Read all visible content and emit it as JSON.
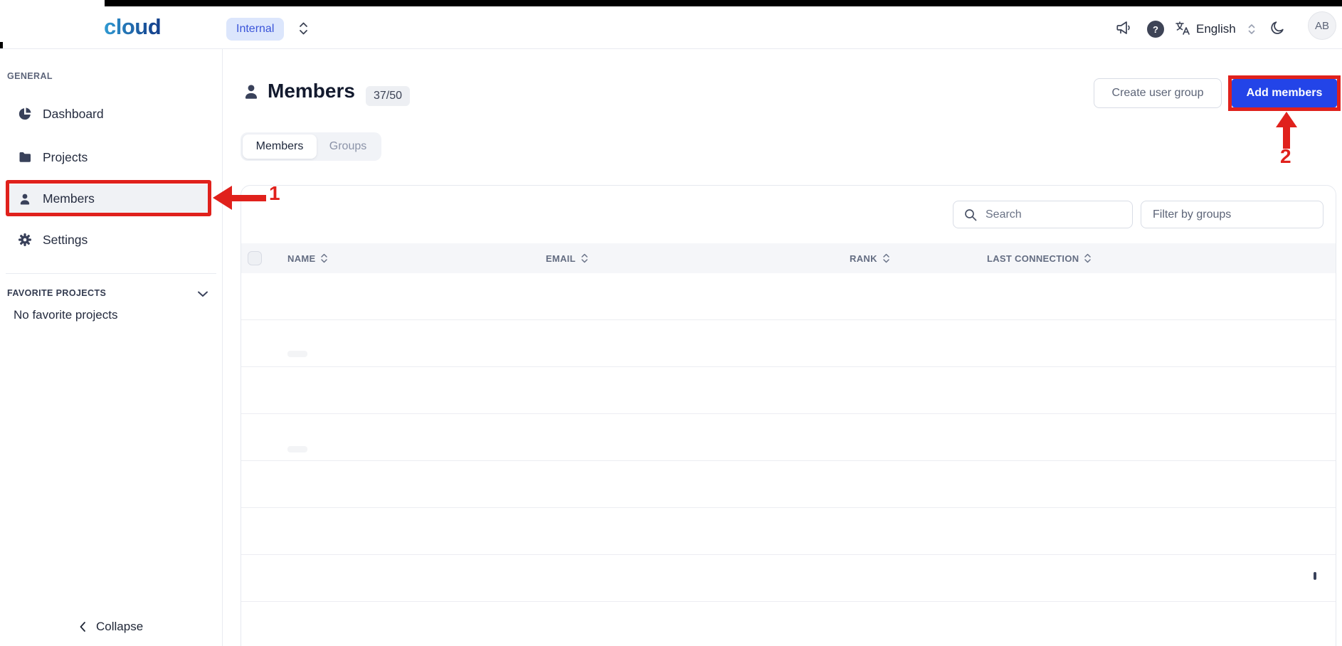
{
  "topbar": {
    "logo": "cloud",
    "org_badge": "Internal",
    "help_glyph": "?",
    "language": "English",
    "avatar_initials": "AB"
  },
  "sidebar": {
    "section_general": "GENERAL",
    "items": [
      {
        "label": "Dashboard",
        "icon": "pie-chart",
        "active": false
      },
      {
        "label": "Projects",
        "icon": "folder",
        "active": false
      },
      {
        "label": "Members",
        "icon": "person",
        "active": true
      },
      {
        "label": "Settings",
        "icon": "gear",
        "active": false
      }
    ],
    "favorites_header": "FAVORITE PROJECTS",
    "favorites_empty": "No favorite projects",
    "collapse_label": "Collapse"
  },
  "main": {
    "title": "Members",
    "count_badge": "37/50",
    "tabs": [
      {
        "label": "Members",
        "active": true
      },
      {
        "label": "Groups",
        "active": false
      }
    ],
    "create_group_button": "Create user group",
    "add_members_button": "Add members",
    "search_placeholder": "Search",
    "filter_button": "Filter by groups",
    "table": {
      "columns": [
        "NAME",
        "EMAIL",
        "RANK",
        "LAST CONNECTION"
      ],
      "rows": []
    }
  },
  "annotations": {
    "step1": "1",
    "step2": "2"
  },
  "colors": {
    "primary_blue": "#2344e8",
    "annotation_red": "#e0211c",
    "org_badge_bg": "#dce6fc",
    "org_badge_text": "#3b55d9",
    "table_header_bg": "#f5f6f9",
    "icon_dark": "#39415a"
  }
}
